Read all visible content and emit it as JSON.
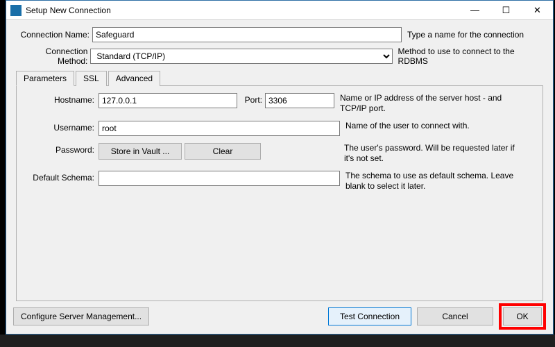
{
  "window": {
    "title": "Setup New Connection"
  },
  "form": {
    "conn_name_label": "Connection Name:",
    "conn_name_value": "Safeguard",
    "conn_name_hint": "Type a name for the connection",
    "conn_method_label": "Connection Method:",
    "conn_method_value": "Standard (TCP/IP)",
    "conn_method_hint": "Method to use to connect to the RDBMS"
  },
  "tabs": {
    "parameters": "Parameters",
    "ssl": "SSL",
    "advanced": "Advanced"
  },
  "params": {
    "hostname_label": "Hostname:",
    "hostname_value": "127.0.0.1",
    "port_label": "Port:",
    "port_value": "3306",
    "host_hint": "Name or IP address of the server host - and TCP/IP port.",
    "username_label": "Username:",
    "username_value": "root",
    "username_hint": "Name of the user to connect with.",
    "password_label": "Password:",
    "store_vault": "Store in Vault ...",
    "clear": "Clear",
    "password_hint": "The user's password. Will be requested later if it's not set.",
    "schema_label": "Default Schema:",
    "schema_value": "",
    "schema_hint": "The schema to use as default schema. Leave blank to select it later."
  },
  "footer": {
    "configure": "Configure Server Management...",
    "test": "Test Connection",
    "cancel": "Cancel",
    "ok": "OK"
  }
}
